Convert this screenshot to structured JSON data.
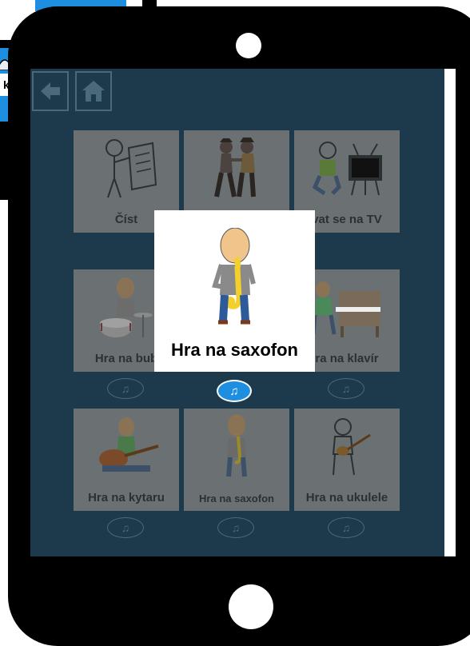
{
  "background": {
    "partial_label": "k"
  },
  "toolbar": {
    "back_icon": "arrow-left-icon",
    "home_icon": "home-icon"
  },
  "tiles": [
    {
      "label": "Číst",
      "icon": "reading-person-icon"
    },
    {
      "label": "",
      "icon": "dancing-couple-icon"
    },
    {
      "label": "vat se na TV",
      "icon": "watching-tv-icon"
    },
    {
      "label": "Hra na bub",
      "icon": "drummer-icon"
    },
    {
      "label": "",
      "icon": "saxophone-icon"
    },
    {
      "label": "ra na klavír",
      "icon": "pianist-icon"
    },
    {
      "label": "Hra na kytaru",
      "icon": "guitarist-icon"
    },
    {
      "label": "Hra na saxofon",
      "icon": "saxophone-player-icon"
    },
    {
      "label": "Hra na ukulele",
      "icon": "ukulele-player-icon"
    }
  ],
  "speak_icon": "music-note-icon",
  "popup": {
    "label": "Hra na saxofon",
    "icon": "saxophone-player-icon"
  },
  "colors": {
    "screen_bg": "#1c3a4c",
    "tile_bg_dimmed": "#6b7173",
    "accent": "#1e8fe0"
  }
}
